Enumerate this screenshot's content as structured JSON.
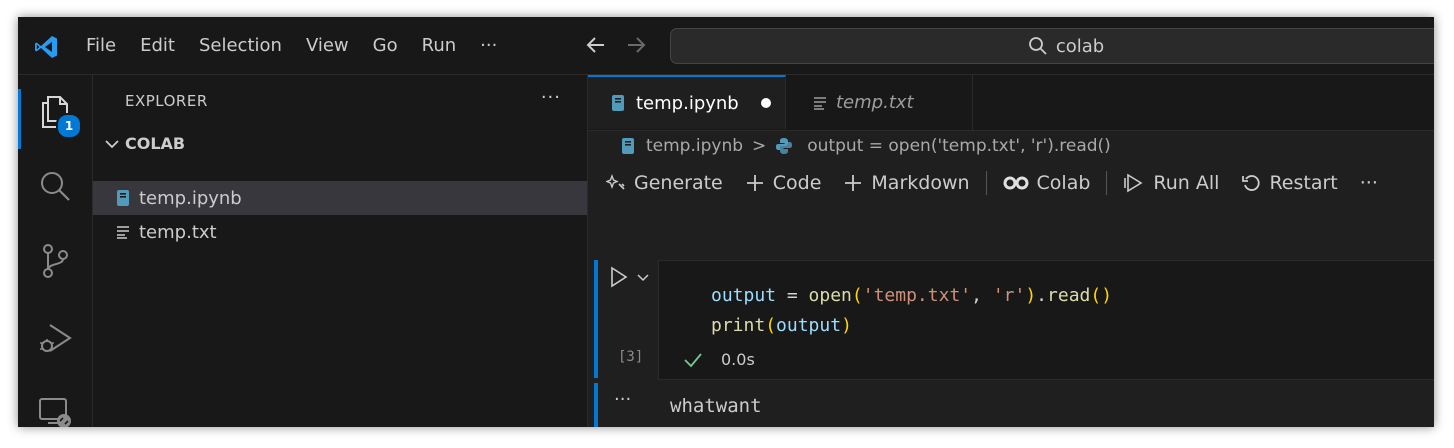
{
  "menu": {
    "items": [
      "File",
      "Edit",
      "Selection",
      "View",
      "Go",
      "Run",
      "···"
    ]
  },
  "search": {
    "text": "colab"
  },
  "activity": {
    "explorer_badge": "1"
  },
  "sidebar": {
    "title": "EXPLORER",
    "more": "···",
    "folder": "COLAB",
    "files": [
      {
        "name": "temp.ipynb",
        "icon": "notebook-icon",
        "selected": true
      },
      {
        "name": "temp.txt",
        "icon": "text-file-icon",
        "selected": false
      }
    ]
  },
  "tabs": [
    {
      "label": "temp.ipynb",
      "active": true,
      "dirty": true
    },
    {
      "label": "temp.txt",
      "active": false
    }
  ],
  "breadcrumb": {
    "file": "temp.ipynb",
    "separator": ">",
    "symbol": "output = open('temp.txt', 'r').read()"
  },
  "toolbar": {
    "generate": "Generate",
    "code": "Code",
    "markdown": "Markdown",
    "colab": "Colab",
    "run_all": "Run All",
    "restart": "Restart",
    "more": "···"
  },
  "cell": {
    "execution_count": "[3]",
    "duration": "0.0s",
    "code_line1": {
      "var": "output",
      "op": " = ",
      "fn": "open",
      "paren_open": "(",
      "arg1": "'temp.txt'",
      "comma": ", ",
      "arg2": "'r'",
      "paren_close": ")",
      "dot": ".",
      "method": "read",
      "call": "()"
    },
    "code_line2": {
      "fn": "print",
      "paren_open": "(",
      "arg": "output",
      "paren_close": ")"
    },
    "output_dots": "···",
    "output": "whatwant"
  },
  "colors": {
    "accent": "#0078d4",
    "success": "#73c991",
    "keyword_var": "#9cdcfe",
    "function": "#dcdcaa",
    "string": "#ce9178",
    "paren": "#ffd700"
  }
}
